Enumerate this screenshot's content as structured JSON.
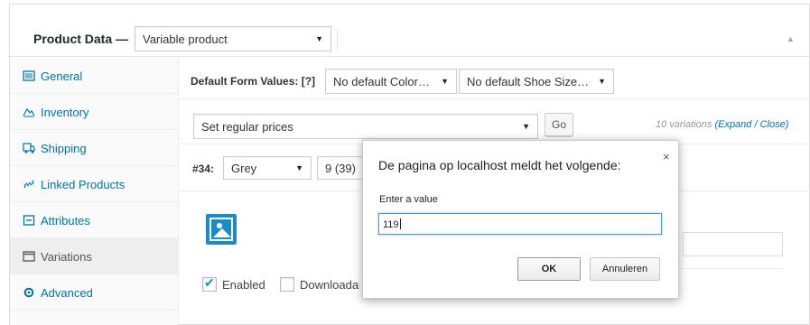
{
  "header": {
    "title": "Product Data —",
    "product_type": "Variable product"
  },
  "sidebar": {
    "items": [
      {
        "label": "General",
        "icon": "general-icon"
      },
      {
        "label": "Inventory",
        "icon": "inventory-icon"
      },
      {
        "label": "Shipping",
        "icon": "truck-icon"
      },
      {
        "label": "Linked Products",
        "icon": "link-icon"
      },
      {
        "label": "Attributes",
        "icon": "attributes-icon"
      },
      {
        "label": "Variations",
        "icon": "variations-icon",
        "active": true
      },
      {
        "label": "Advanced",
        "icon": "gear-icon"
      }
    ]
  },
  "default_form": {
    "label": "Default Form Values: [?]",
    "color": "No default Color…",
    "shoe_size": "No default Shoe Size…"
  },
  "bulk": {
    "action": "Set regular prices",
    "go_label": "Go",
    "count_text": "10 variations",
    "expand_label": "(Expand / Close)"
  },
  "variation": {
    "number": "#34:",
    "color": "Grey",
    "size": "9 (39)",
    "enabled_label": "Enabled",
    "enabled_checked": true,
    "downloadable_label": "Downloadable"
  },
  "dialog": {
    "title": "De pagina op localhost meldt het volgende:",
    "close_glyph": "×",
    "prompt": "Enter a value",
    "input_value": "119",
    "ok_label": "OK",
    "cancel_label": "Annuleren"
  },
  "colors": {
    "link": "#0073aa",
    "thumb": "#1a8bc7",
    "focus": "#4d90fe"
  }
}
